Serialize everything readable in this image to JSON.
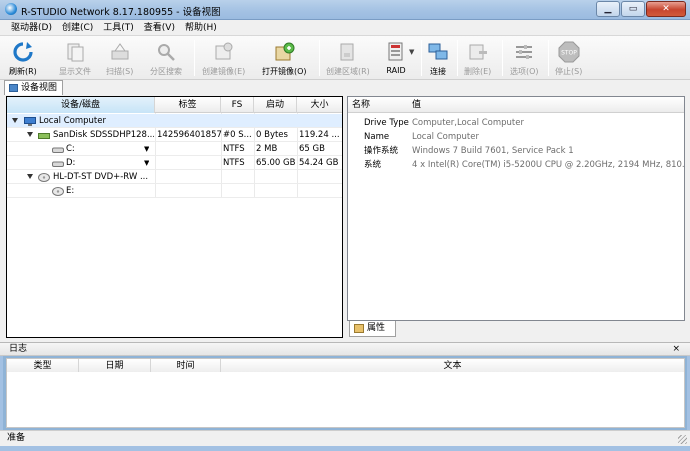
{
  "window": {
    "title": "R-STUDIO Network 8.17.180955 - 设备视图"
  },
  "menu": [
    "驱动器(D)",
    "创建(C)",
    "工具(T)",
    "查看(V)",
    "帮助(H)"
  ],
  "toolbar": {
    "refresh": "刷新(R)",
    "show_files": "显示文件",
    "scan": "扫描(S)",
    "partition_search": "分区搜索",
    "create_image": "创建镜像(E)",
    "open_image": "打开镜像(O)",
    "create_region": "创建区域(R)",
    "raid": "RAID",
    "connect": "连接",
    "delete": "删除(E)",
    "options": "选项(O)",
    "stop": "停止(S)"
  },
  "device_tab": "设备视图",
  "device_columns": [
    "设备/磁盘",
    "标签",
    "FS",
    "启动",
    "大小"
  ],
  "devices": [
    {
      "name": "Local Computer",
      "label": "",
      "fs": "",
      "start": "",
      "size": ""
    },
    {
      "name": "SanDisk SDSSDHP128...",
      "label": "142596401857",
      "fs": "#0 S...",
      "start": "0 Bytes",
      "size": "119.24 ..."
    },
    {
      "name": "C:",
      "label": "",
      "fs": "NTFS",
      "start": "2 MB",
      "size": "65 GB"
    },
    {
      "name": "D:",
      "label": "",
      "fs": "NTFS",
      "start": "65.00 GB",
      "size": "54.24 GB"
    },
    {
      "name": "HL-DT-ST DVD+-RW ...",
      "label": "",
      "fs": "",
      "start": "",
      "size": ""
    },
    {
      "name": "E:",
      "label": "",
      "fs": "",
      "start": "",
      "size": ""
    }
  ],
  "properties": {
    "col_name": "名称",
    "col_value": "值",
    "rows": [
      {
        "key": "Drive Type",
        "value": "Computer,Local Computer"
      },
      {
        "key": "Name",
        "value": "Local Computer"
      },
      {
        "key": "操作系统",
        "value": "Windows 7 Build 7601, Service Pack 1"
      },
      {
        "key": "系统",
        "value": "4 x Intel(R) Core(TM) i5-5200U CPU @ 2.20GHz, 2194 MHz, 810..."
      }
    ],
    "tab": "属性"
  },
  "log": {
    "title": "日志",
    "close": "×",
    "columns": [
      "类型",
      "日期",
      "时间",
      "文本"
    ]
  },
  "status": "准备"
}
